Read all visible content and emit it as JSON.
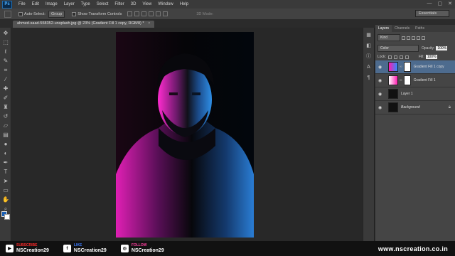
{
  "app": {
    "logo": "Ps",
    "menu": [
      "File",
      "Edit",
      "Image",
      "Layer",
      "Type",
      "Select",
      "Filter",
      "3D",
      "View",
      "Window",
      "Help"
    ],
    "window_controls": [
      "—",
      "▢",
      "✕"
    ]
  },
  "options_bar": {
    "auto_select_label": "Auto-Select:",
    "auto_select_value": "Group",
    "show_transform_label": "Show Transform Controls",
    "mode_3d_label": "3D Mode:",
    "workspace": "Essentials"
  },
  "document": {
    "tab_title": "ahmed-saad-558352-unsplash.jpg @ 23% (Gradient Fill 1 copy, RGB/8) *",
    "close_glyph": "×"
  },
  "toolbox": {
    "tools": [
      "move-icon",
      "marquee-icon",
      "lasso-icon",
      "quick-select-icon",
      "crop-icon",
      "eyedropper-icon",
      "healing-icon",
      "brush-icon",
      "clone-stamp-icon",
      "history-brush-icon",
      "eraser-icon",
      "gradient-icon",
      "blur-icon",
      "dodge-icon",
      "pen-icon",
      "type-icon",
      "path-select-icon",
      "shape-icon",
      "hand-icon",
      "zoom-icon"
    ],
    "foreground_color": "#1a5fb4",
    "background_color": "#ffffff"
  },
  "layers_panel": {
    "tabs": [
      "Layers",
      "Channels",
      "Paths"
    ],
    "active_tab": "Layers",
    "filter_kind": "Kind",
    "blend_mode": "Color",
    "opacity_label": "Opacity:",
    "opacity_value": "100%",
    "lock_label": "Lock:",
    "fill_label": "Fill:",
    "fill_value": "100%",
    "layers": [
      {
        "name": "Gradient Fill 1 copy",
        "selected": true,
        "type": "gradient"
      },
      {
        "name": "Gradient Fill 1",
        "selected": false,
        "type": "gradient"
      },
      {
        "name": "Layer 1",
        "selected": false,
        "type": "pixel"
      },
      {
        "name": "Background",
        "selected": false,
        "type": "background",
        "locked": true
      }
    ]
  },
  "footer": {
    "youtube": {
      "label": "SUBSCRIBE",
      "handle": "NSCreation29",
      "color": "#ff2a2a"
    },
    "facebook": {
      "label": "LIKE",
      "handle": "NSCreation29",
      "color": "#3b7bff"
    },
    "instagram": {
      "label": "FOLLOW",
      "handle": "NSCreation29",
      "color": "#ff3fa0"
    },
    "website": "www.nscreation.co.in"
  }
}
